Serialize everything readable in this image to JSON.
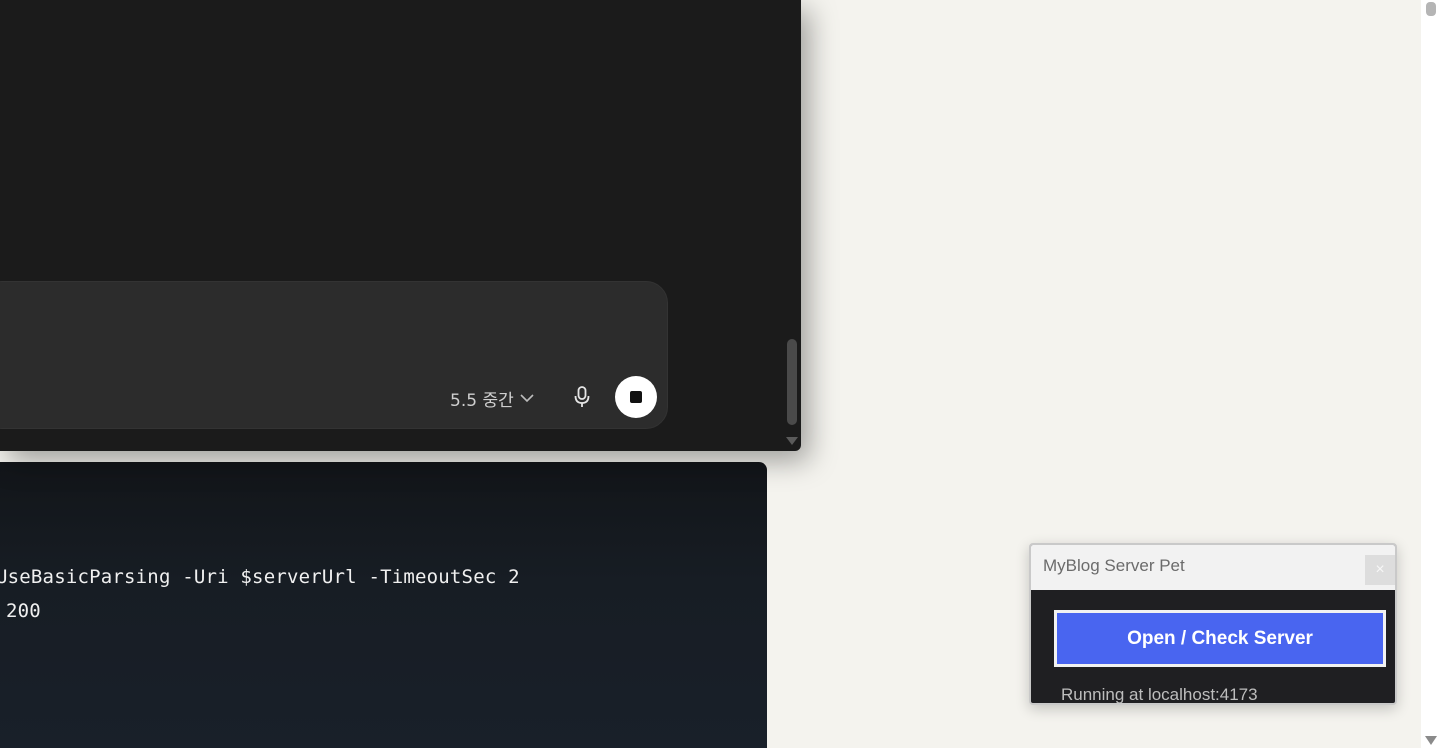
{
  "chat": {
    "model_label": "5.5 중간",
    "icons": {
      "model_dropdown": "chevron-down-icon",
      "microphone": "microphone-icon",
      "stop": "stop-icon"
    }
  },
  "terminal": {
    "lines": [
      "UseBasicParsing -Uri $serverUrl -TimeoutSec 2",
      "200"
    ]
  },
  "server_pet": {
    "title": "MyBlog Server Pet",
    "close_label": "×",
    "open_button_label": "Open / Check Server",
    "status": "Running at localhost:4173",
    "accent_color": "#4965f0"
  }
}
